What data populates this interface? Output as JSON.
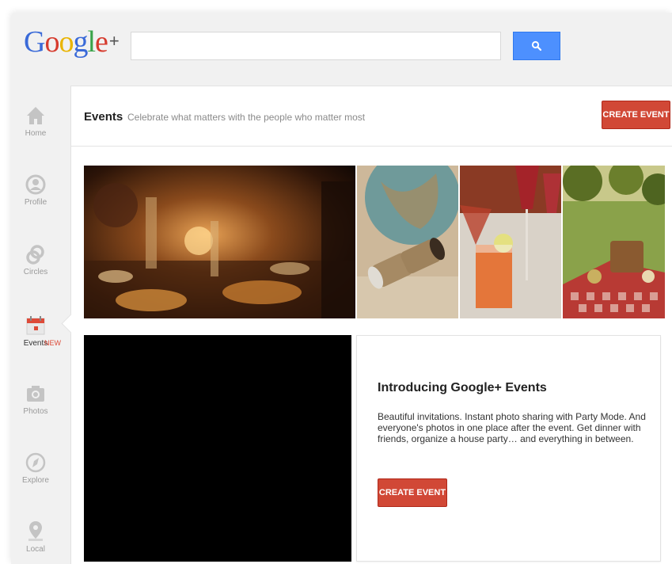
{
  "app": {
    "logo": "Google+"
  },
  "search": {
    "value": "",
    "placeholder": ""
  },
  "nav": {
    "items": [
      {
        "label": "Home",
        "icon": "home-icon"
      },
      {
        "label": "Profile",
        "icon": "profile-icon"
      },
      {
        "label": "Circles",
        "icon": "circles-icon"
      },
      {
        "label": "Events",
        "icon": "calendar-icon",
        "badge": "NEW",
        "active": true
      },
      {
        "label": "Photos",
        "icon": "camera-icon"
      },
      {
        "label": "Explore",
        "icon": "compass-icon"
      },
      {
        "label": "Local",
        "icon": "map-pin-icon"
      }
    ]
  },
  "header": {
    "title": "Events",
    "subtitle": "Celebrate what matters with the people who matter most",
    "create_button": "CREATE EVENT"
  },
  "intro": {
    "title": "Introducing Google+ Events",
    "body": "Beautiful invitations. Instant photo sharing with Party Mode. And everyone's photos in one place after the event. Get dinner with friends, organize a house party… and everything in between.",
    "create_button": "CREATE EVENT"
  },
  "colors": {
    "accent_red": "#d14836",
    "search_blue": "#4d90fe",
    "nav_grey": "#b8b8b8",
    "events_red": "#dd4b39"
  }
}
